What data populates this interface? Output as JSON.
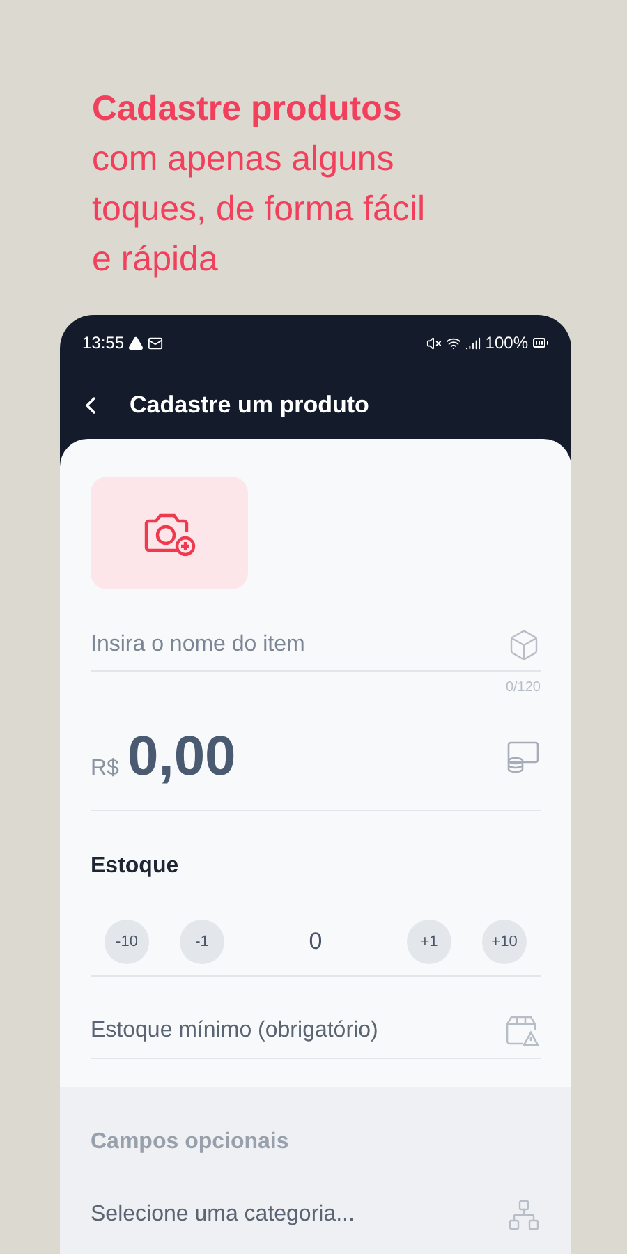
{
  "headline": "**Cadastre produtos** com apenas alguns toques, de forma fácil e rápida",
  "status_bar": {
    "time": "13:55",
    "battery": "100%"
  },
  "header": {
    "title": "Cadastre um produto"
  },
  "form": {
    "name_field": {
      "placeholder": "Insira o nome do item",
      "counter": "0/120"
    },
    "price": {
      "currency": "R$",
      "value": "0,00"
    },
    "stock": {
      "label": "Estoque",
      "decrements": [
        "-10",
        "-1"
      ],
      "value": "0",
      "increments": [
        "+1",
        "+10"
      ]
    },
    "min_stock": {
      "placeholder": "Estoque mínimo (obrigatório)"
    },
    "optional": {
      "title": "Campos opcionais",
      "category": {
        "placeholder": "Selecione uma categoria..."
      }
    }
  }
}
